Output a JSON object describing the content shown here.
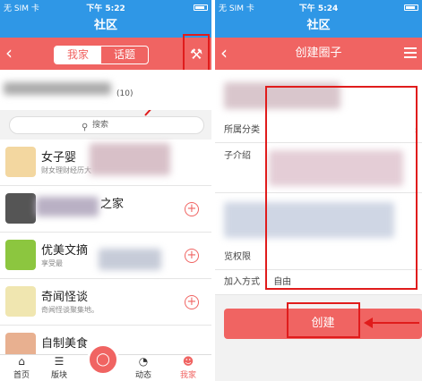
{
  "left": {
    "status": {
      "carrier": "无 SIM 卡",
      "time": "下午 5:22"
    },
    "header": {
      "title": "社区"
    },
    "tabs": {
      "mine": "我家",
      "topic": "话题"
    },
    "count": "(10)",
    "search": {
      "placeholder": "搜索"
    },
    "items": [
      {
        "title": "女子婴",
        "sub": "财女理财经历大"
      },
      {
        "title": "之家",
        "sub": ""
      },
      {
        "title": "优美文摘",
        "sub": "享受最"
      },
      {
        "title": "奇闻怪谈",
        "sub": "奇闻怪谈聚集地。"
      },
      {
        "title": "自制美食",
        "sub": ""
      }
    ],
    "tabbar": {
      "home": "首页",
      "board": "版块",
      "news": "动态",
      "me": "我家"
    },
    "accent": "#f06462"
  },
  "right": {
    "status": {
      "carrier": "无 SIM 卡",
      "time": "下午 5:24"
    },
    "header": {
      "title": "社区"
    },
    "nav_title": "创建圈子",
    "form": {
      "category": "所属分类",
      "intro": "子介绍",
      "permission": "览权限",
      "join": "加入方式",
      "join_value": "自由"
    },
    "create_label": "创建"
  },
  "icons": {
    "back": "back-chevron-icon",
    "tools": "tools-icon",
    "menu": "menu-icon",
    "search": "search-icon",
    "plus": "plus-circle-icon",
    "home": "home-icon",
    "board": "list-icon",
    "fab": "lightbulb-icon",
    "news": "activity-icon",
    "me": "person-icon"
  }
}
